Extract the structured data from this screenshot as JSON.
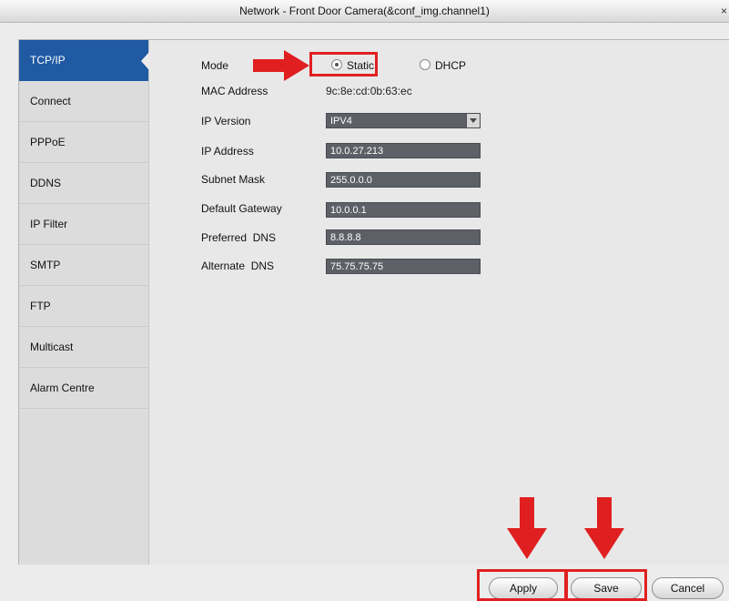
{
  "window": {
    "title": "Network - Front Door Camera(&conf_img.channel1)",
    "close_glyph": "×"
  },
  "sidebar": {
    "items": [
      {
        "label": "TCP/IP",
        "active": true
      },
      {
        "label": "Connect"
      },
      {
        "label": "PPPoE"
      },
      {
        "label": "DDNS"
      },
      {
        "label": "IP Filter"
      },
      {
        "label": "SMTP"
      },
      {
        "label": "FTP"
      },
      {
        "label": "Multicast"
      },
      {
        "label": "Alarm Centre"
      }
    ]
  },
  "form": {
    "mode_label": "Mode",
    "mode_static": "Static",
    "mode_dhcp": "DHCP",
    "mode_selected": "Static",
    "mac_label": "MAC Address",
    "mac_value": "9c:8e:cd:0b:63:ec",
    "ip_version_label": "IP Version",
    "ip_version_value": "IPV4",
    "ip_address_label": "IP Address",
    "ip_address_value": "10.0.27.213",
    "subnet_label": "Subnet Mask",
    "subnet_value": "255.0.0.0",
    "gateway_label": "Default Gateway",
    "gateway_value": "10.0.0.1",
    "preferred_dns_label": "Preferred  DNS",
    "preferred_dns_value": "8.8.8.8",
    "alternate_dns_label": "Alternate  DNS",
    "alternate_dns_value": "75.75.75.75"
  },
  "buttons": {
    "apply": "Apply",
    "save": "Save",
    "cancel": "Cancel"
  },
  "colors": {
    "annotation_red": "#e02020",
    "active_tab": "#1f5aa3",
    "field_bg": "#5e6068"
  }
}
